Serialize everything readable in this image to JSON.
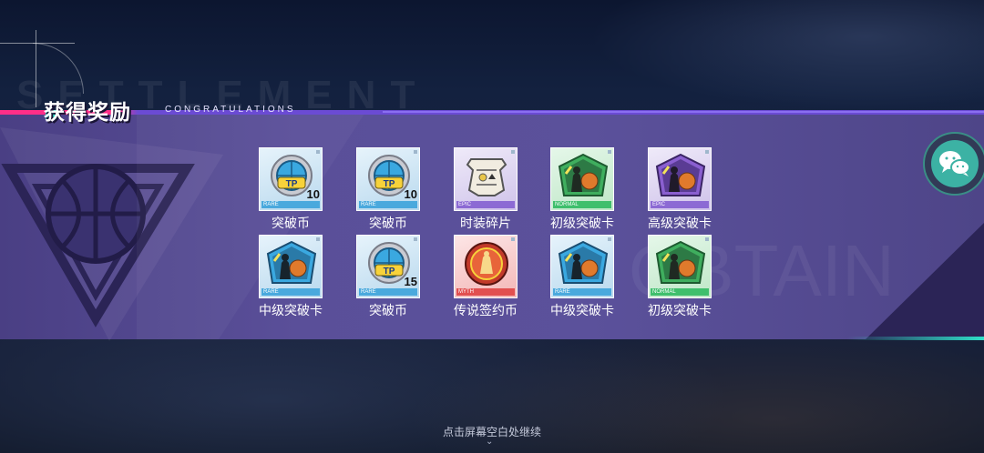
{
  "header": {
    "bg_word": "SETTLEMENT",
    "title": "获得奖励",
    "subtitle": "CONGRATULATIONS"
  },
  "items": [
    {
      "name": "突破币",
      "rarity": "RARE",
      "count": "10",
      "kind": "tp-coin"
    },
    {
      "name": "突破币",
      "rarity": "RARE",
      "count": "10",
      "kind": "tp-coin"
    },
    {
      "name": "时装碎片",
      "rarity": "EPIC",
      "count": "",
      "kind": "fashion-shard"
    },
    {
      "name": "初级突破卡",
      "rarity": "NORMAL",
      "count": "",
      "kind": "breakthrough-card"
    },
    {
      "name": "高级突破卡",
      "rarity": "EPIC",
      "count": "",
      "kind": "breakthrough-card"
    },
    {
      "name": "中级突破卡",
      "rarity": "RARE",
      "count": "",
      "kind": "breakthrough-card"
    },
    {
      "name": "突破币",
      "rarity": "RARE",
      "count": "15",
      "kind": "tp-coin"
    },
    {
      "name": "传说签约币",
      "rarity": "MYTH",
      "count": "",
      "kind": "legend-coin"
    },
    {
      "name": "中级突破卡",
      "rarity": "RARE",
      "count": "",
      "kind": "breakthrough-card"
    },
    {
      "name": "初级突破卡",
      "rarity": "NORMAL",
      "count": "",
      "kind": "breakthrough-card"
    }
  ],
  "footer": {
    "continue_text": "点击屏幕空白处继续",
    "chevron": "⌄"
  },
  "colors": {
    "panel": "#5a4f99",
    "accent_pink": "#ff2e88",
    "accent_teal": "#2fe0c8",
    "rare": "#4aa9dd",
    "epic": "#8c6ad4",
    "normal": "#3fbf6c",
    "myth": "#e15050"
  },
  "icons": {
    "chat": "wechat-icon",
    "background_badge": "basketball-emblem-icon"
  }
}
